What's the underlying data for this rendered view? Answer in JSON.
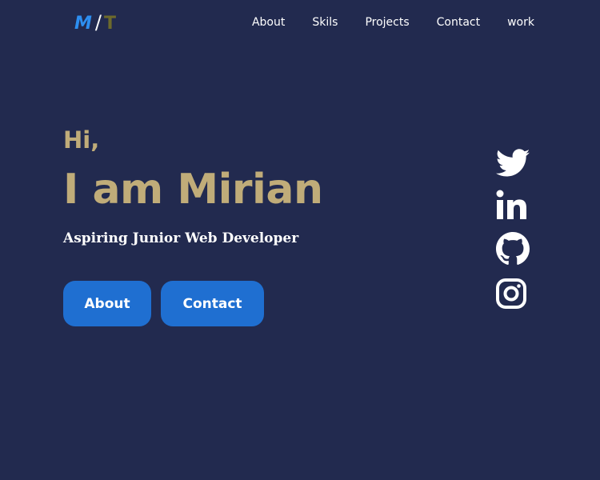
{
  "logo": {
    "first": "M",
    "separator": "/",
    "last": "T"
  },
  "nav": {
    "items": [
      "About",
      "Skils",
      "Projects",
      "Contact",
      "work"
    ]
  },
  "hero": {
    "greeting": "Hi,",
    "name": "I am Mirian",
    "tagline": "Aspiring Junior Web Developer"
  },
  "buttons": {
    "about_label": "About",
    "contact_label": "Contact"
  },
  "social": {
    "icons": [
      "twitter-icon",
      "linkedin-icon",
      "github-icon",
      "instagram-icon"
    ]
  },
  "colors": {
    "background": "#222a4f",
    "accent_gold": "#c0ac79",
    "button_blue": "#1f6fd1",
    "logo_blue": "#2d8ef0",
    "logo_olive": "#6d6a2c",
    "text_white": "#ffffff"
  }
}
